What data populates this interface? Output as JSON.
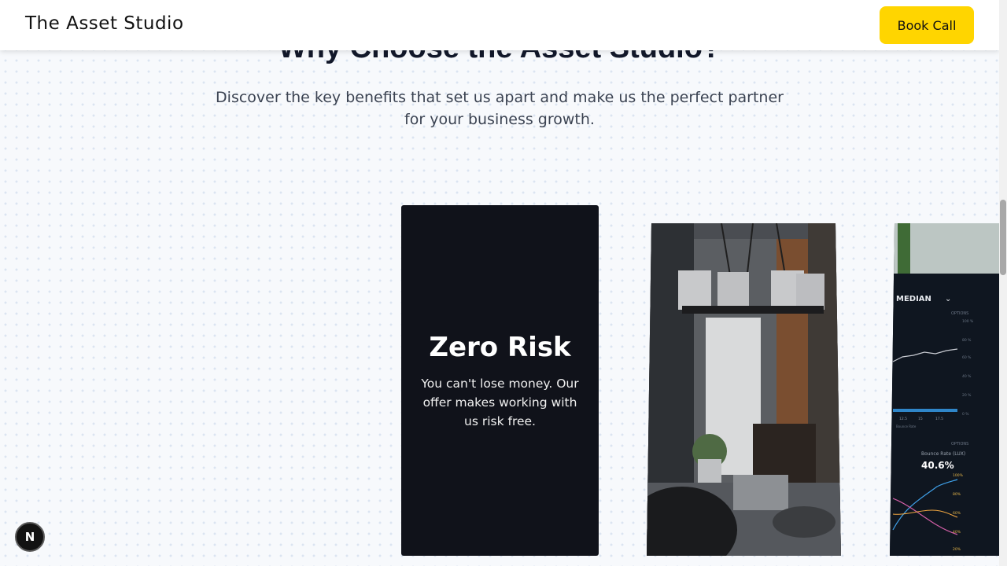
{
  "header": {
    "brand": "The Asset Studio",
    "cta_label": "Book Call",
    "cta_color": "#ffd500"
  },
  "section": {
    "title": "Why Choose the Asset Studio?",
    "subtitle": "Discover the key benefits that set us apart and make us the perfect partner for your business growth."
  },
  "cards": {
    "risk": {
      "title": "Zero Risk",
      "text": "You can't lose money. Our offer makes working with us risk free."
    },
    "photo": {
      "subject": "office-workspace-photo"
    },
    "dashboard": {
      "filter_label": "MEDIAN",
      "options_label": "OPTIONS",
      "bounce_label": "Bounce Rate (LUX)",
      "bounce_value": "40.6%",
      "legend_label": "Bounce Rate",
      "y_ticks": [
        "100 %",
        "80 %",
        "60 %",
        "40 %",
        "20 %",
        "0 %"
      ],
      "x_ticks": [
        "12.5",
        "15",
        "17.5"
      ],
      "lower_ticks": [
        "100%",
        "80%",
        "60%",
        "40%",
        "20%"
      ]
    }
  },
  "badge": {
    "letter": "N"
  },
  "colors": {
    "accent": "#ffd500",
    "dark_card": "#10121a",
    "title_text": "#12182a"
  }
}
